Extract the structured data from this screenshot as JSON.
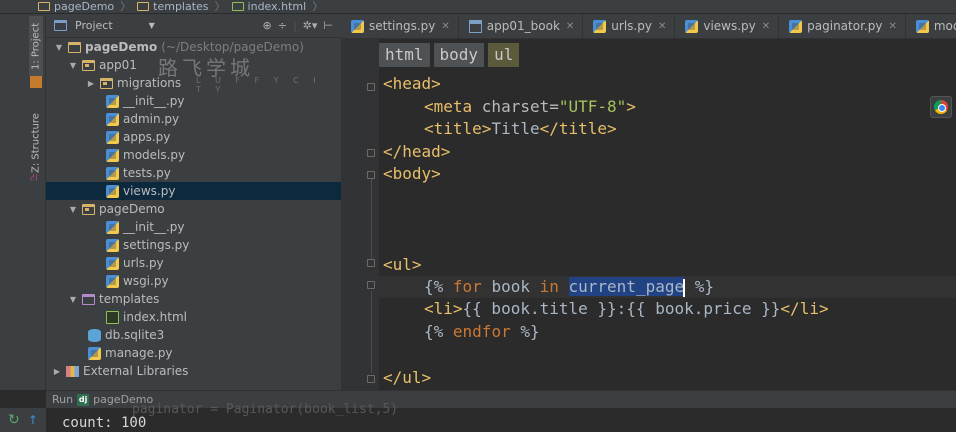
{
  "nav": {
    "crumbs": [
      "pageDemo",
      "templates",
      "index.html"
    ]
  },
  "stripe": {
    "project_tab": "1: Project",
    "structure_tab": "Z: Structure"
  },
  "project": {
    "view_name": "Project",
    "tree": {
      "root": "pageDemo",
      "root_path": "(~/Desktop/pageDemo)",
      "app01": "app01",
      "migrations": "migrations",
      "app_init": "__init__.py",
      "admin": "admin.py",
      "apps": "apps.py",
      "models": "models.py",
      "tests": "tests.py",
      "views": "views.py",
      "pkg": "pageDemo",
      "pkg_init": "__init__.py",
      "settings": "settings.py",
      "urls": "urls.py",
      "wsgi": "wsgi.py",
      "templates": "templates",
      "index": "index.html",
      "db": "db.sqlite3",
      "manage": "manage.py",
      "external": "External Libraries"
    },
    "watermark": "路飞学城",
    "watermark_sub": "L U F F Y C I T Y"
  },
  "tabs": [
    {
      "label": "settings.py",
      "icon": "python-file-icon"
    },
    {
      "label": "app01_book",
      "icon": "table-icon"
    },
    {
      "label": "urls.py",
      "icon": "python-file-icon"
    },
    {
      "label": "views.py",
      "icon": "python-file-icon"
    },
    {
      "label": "paginator.py",
      "icon": "python-file-icon"
    },
    {
      "label": "models.py",
      "icon": "python-file-icon"
    }
  ],
  "editor": {
    "breadcrumbs": [
      "html",
      "body",
      "ul"
    ],
    "code": {
      "head_open": "<head>",
      "meta_open": "<meta ",
      "meta_attr": "charset=",
      "meta_val": "\"UTF-8\"",
      "meta_close": ">",
      "title_open": "<title>",
      "title_text": "Title",
      "title_close": "</title>",
      "head_close": "</head>",
      "body_open": "<body>",
      "ul_open": "<ul>",
      "for_open": "{% ",
      "for_kw": "for",
      "for_var": " book ",
      "in_kw": "in",
      "for_sel": "current_page",
      "for_close": " %}",
      "li_open": "<li>",
      "li_expr": "{{ book.title }}:{{ book.price }}",
      "li_close": "</li>",
      "endfor_open": "{% ",
      "endfor_kw": "endfor",
      "endfor_close": " %}",
      "ul_close": "</ul>"
    }
  },
  "run": {
    "label": "Run",
    "config": "pageDemo",
    "ghost_line": "paginator = Paginator(book_list,5)",
    "output": "count: 100"
  }
}
